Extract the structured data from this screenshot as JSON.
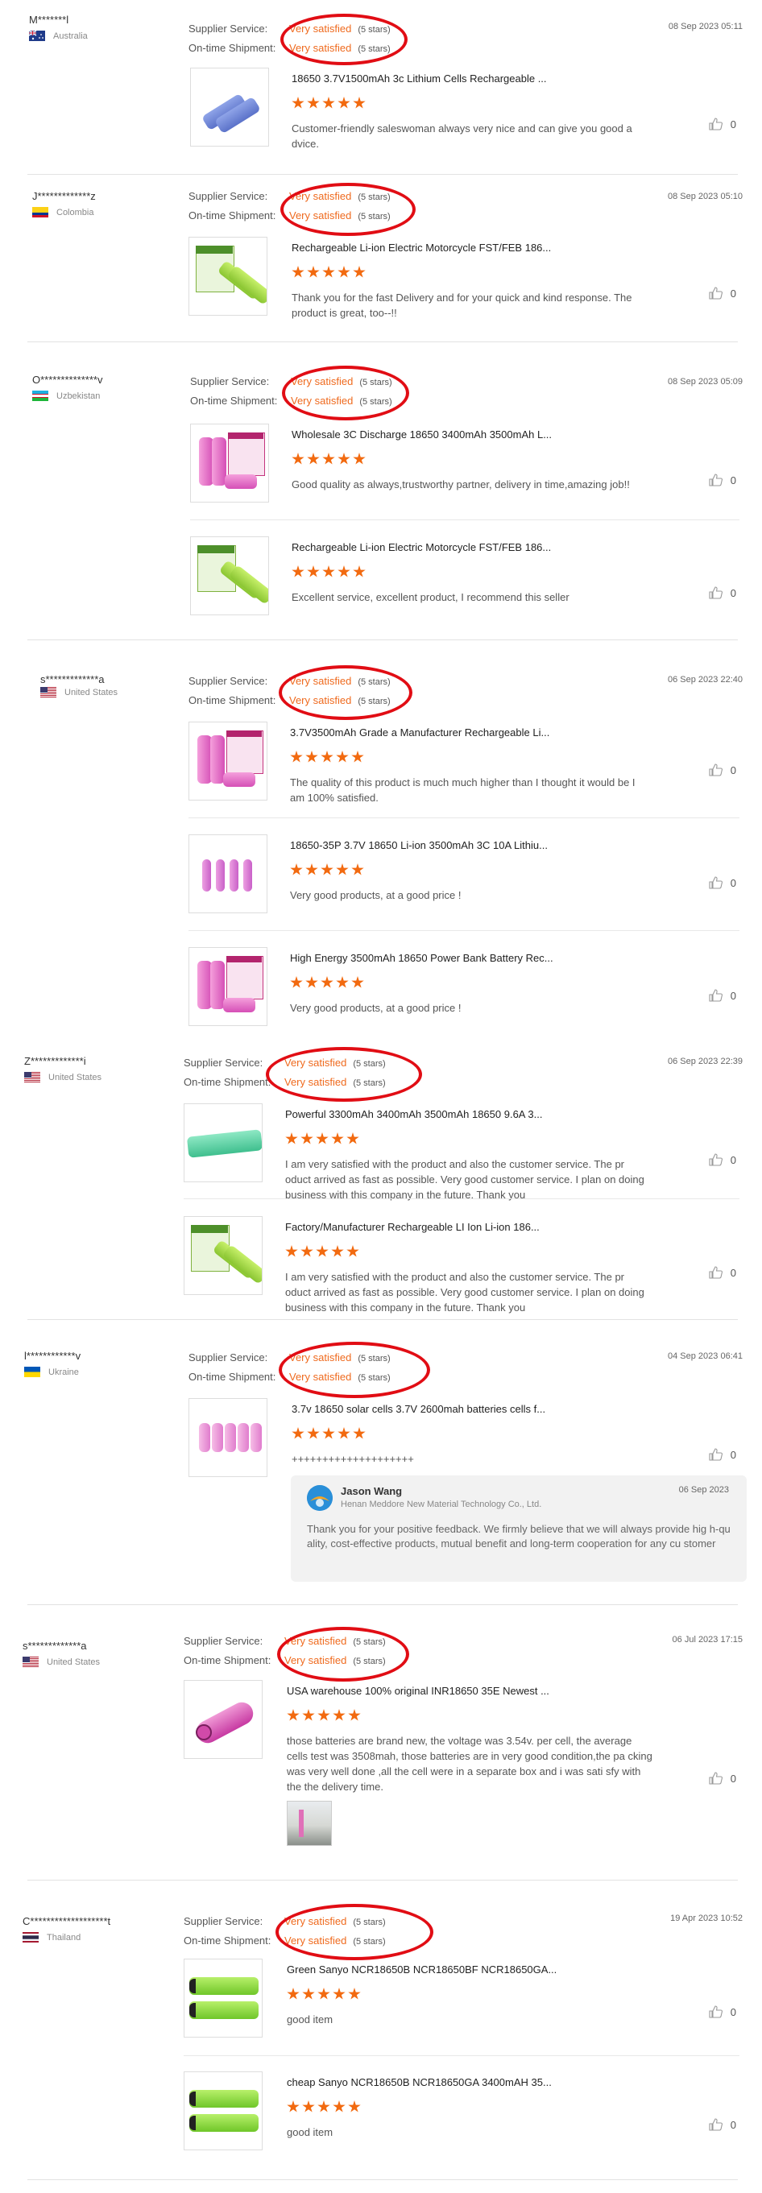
{
  "labels": {
    "supplier_service": "Supplier Service:",
    "ontime_shipment": "On-time Shipment:",
    "satisfied": "Very satisfied",
    "stars_5": "(5 stars)"
  },
  "colors": {
    "accent": "#ef6a1e",
    "star": "#f26a10",
    "annotation_oval": "#e10d14"
  },
  "reviews": [
    {
      "buyer": "M*******l",
      "country": "Australia",
      "date": "08 Sep 2023 05:11",
      "items": [
        {
          "title": "18650 3.7V1500mAh 3c Lithium Cells Rechargeable ...",
          "text": "Customer-friendly saleswoman always very nice and can give you good a dvice.",
          "likes": "0",
          "thumb": "blue-batteries"
        }
      ]
    },
    {
      "buyer": "J*************z",
      "country": "Colombia",
      "date": "08 Sep 2023 05:10",
      "items": [
        {
          "title": "Rechargeable Li-ion Electric Motorcycle FST/FEB 186...",
          "text": "Thank you for the fast  Delivery and for your quick and kind response. The product is great, too--!!",
          "likes": "0",
          "thumb": "green-batteries-box"
        }
      ]
    },
    {
      "buyer": "O**************v",
      "country": "Uzbekistan",
      "date": "08 Sep 2023 05:09",
      "items": [
        {
          "title": "Wholesale 3C Discharge 18650 3400mAh 3500mAh L...",
          "text": "Good quality as always,trustworthy partner, delivery in time,amazing job!!",
          "likes": "0",
          "thumb": "pink-batteries-box"
        },
        {
          "title": "Rechargeable Li-ion Electric Motorcycle FST/FEB 186...",
          "text": "Excellent service, excellent product, I recommend this seller",
          "likes": "0",
          "thumb": "green-batteries-box"
        }
      ]
    },
    {
      "buyer": "s*************a",
      "country": "United States",
      "date": "06 Sep 2023 22:40",
      "items": [
        {
          "title": "3.7V3500mAh Grade a Manufacturer Rechargeable Li...",
          "text": "The quality of this product is much much higher than I thought it would be I am 100% satisfied.",
          "likes": "0",
          "thumb": "pink-batteries-box"
        },
        {
          "title": "18650-35P 3.7V 18650 Li-ion 3500mAh 3C 10A Lithiu...",
          "text": " Very good products, at a good price !",
          "likes": "0",
          "thumb": "pink-row"
        },
        {
          "title": "High Energy 3500mAh 18650 Power Bank Battery Rec...",
          "text": " Very good products, at a good price !",
          "likes": "0",
          "thumb": "pink-batteries-box"
        }
      ]
    },
    {
      "buyer": "Z*************i",
      "country": "United States",
      "date": "06 Sep 2023 22:39",
      "items": [
        {
          "title": "Powerful 3300mAh 3400mAh 3500mAh 18650 9.6A 3...",
          "text": "I am very satisfied with the product and also the customer service.  The pr oduct arrived as fast as possible.  Very good customer service.  I plan on doing business with this company in the future.  Thank you",
          "likes": "0",
          "thumb": "teal-battery"
        },
        {
          "title": "Factory/Manufacturer Rechargeable LI Ion Li-ion 186...",
          "text": "I am very satisfied with the product and also the customer service.  The pr oduct arrived as fast as possible.  Very good customer service.  I plan on doing business with this company in the future.  Thank you",
          "likes": "0",
          "thumb": "green-batteries-box"
        }
      ]
    },
    {
      "buyer": "l************v",
      "country": "Ukraine",
      "date": "04 Sep 2023 06:41",
      "items": [
        {
          "title": "3.7v 18650 solar cells 3.7V 2600mah batteries cells f...",
          "text": "++++++++++++++++++++",
          "likes": "0",
          "thumb": "pink-pile"
        }
      ],
      "reply": {
        "name": "Jason Wang",
        "company": "Henan Meddore New Material Technology Co., Ltd.",
        "date": "06 Sep 2023",
        "text": "Thank you for your positive feedback. We firmly believe that we will always provide hig h-quality, cost-effective products, mutual benefit and long-term cooperation for any cu stomer"
      }
    },
    {
      "buyer": "s*************a",
      "country": "United States",
      "date": "06 Jul 2023 17:15",
      "items": [
        {
          "title": "USA warehouse 100% original INR18650 35E Newest ...",
          "text": "those batteries are brand new, the voltage was 3.54v. per cell, the average cells test was 3508mah, those batteries are in very good condition,the pa cking was very well done ,all the cell were in a separate box and i was sati sfy with the the delivery time.",
          "likes": "0",
          "thumb": "magenta-battery"
        }
      ]
    },
    {
      "buyer": "C*******************t",
      "country": "Thailand",
      "date": "19 Apr 2023 10:52",
      "items": [
        {
          "title": "Green Sanyo NCR18650B NCR18650BF NCR18650GA...",
          "text": "good item",
          "likes": "0",
          "thumb": "lime-batteries"
        },
        {
          "title": "cheap Sanyo NCR18650B NCR18650GA 3400mAH 35...",
          "text": "good item",
          "likes": "0",
          "thumb": "lime-batteries"
        }
      ]
    }
  ]
}
